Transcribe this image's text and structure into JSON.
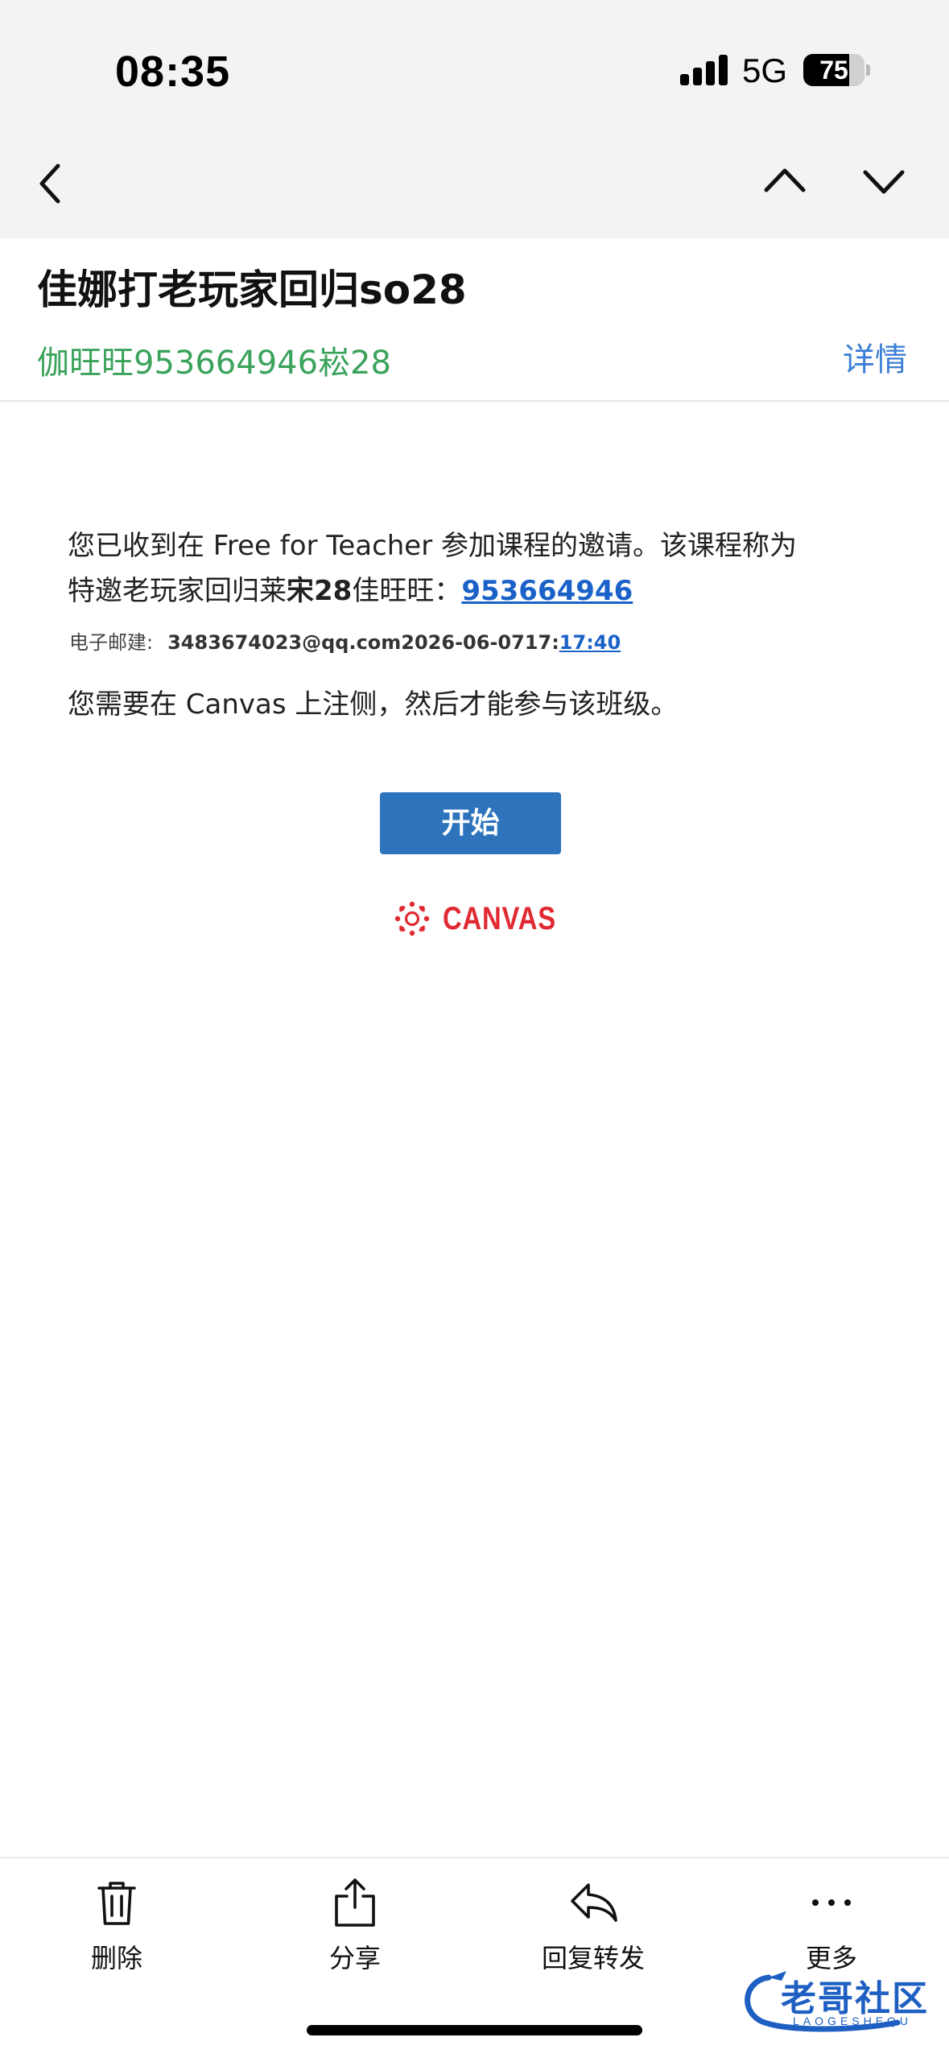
{
  "status_bar": {
    "time": "08:35",
    "network": "5G",
    "battery": "75",
    "battery_level": 0.75
  },
  "email": {
    "subject": "佳娜打老玩家回归so28",
    "sender": "伽旺旺953664946崧28",
    "details_label": "详情",
    "body": {
      "line1": "您已收到在 Free for Teacher 参加课程的邀请。该课程称为",
      "line2_prefix": "特邀老玩家回归莱",
      "line2_bold": "宋28",
      "line2_suffix": "佳旺旺：",
      "course_link": "953664946",
      "email_label": "电子邮建:",
      "email_address": "3483674023@qq.com2026-06-0717:",
      "email_time_link": "17:40",
      "line3": "您需要在 Canvas 上注侧，然后才能参与该班级。"
    },
    "start_button": "开始",
    "logo_text": "CANVAS"
  },
  "toolbar": {
    "items": [
      {
        "label": "删除",
        "icon": "trash-icon"
      },
      {
        "label": "分享",
        "icon": "share-icon"
      },
      {
        "label": "回复转发",
        "icon": "reply-icon"
      },
      {
        "label": "更多",
        "icon": "more-icon"
      }
    ]
  },
  "watermark": {
    "text": "老哥社区",
    "sub": "LAOGESHEQU"
  },
  "colors": {
    "sender_green": "#3aa35b",
    "link_blue": "#1a62c7",
    "button_blue": "#2e74bd",
    "canvas_red": "#e02a33"
  }
}
